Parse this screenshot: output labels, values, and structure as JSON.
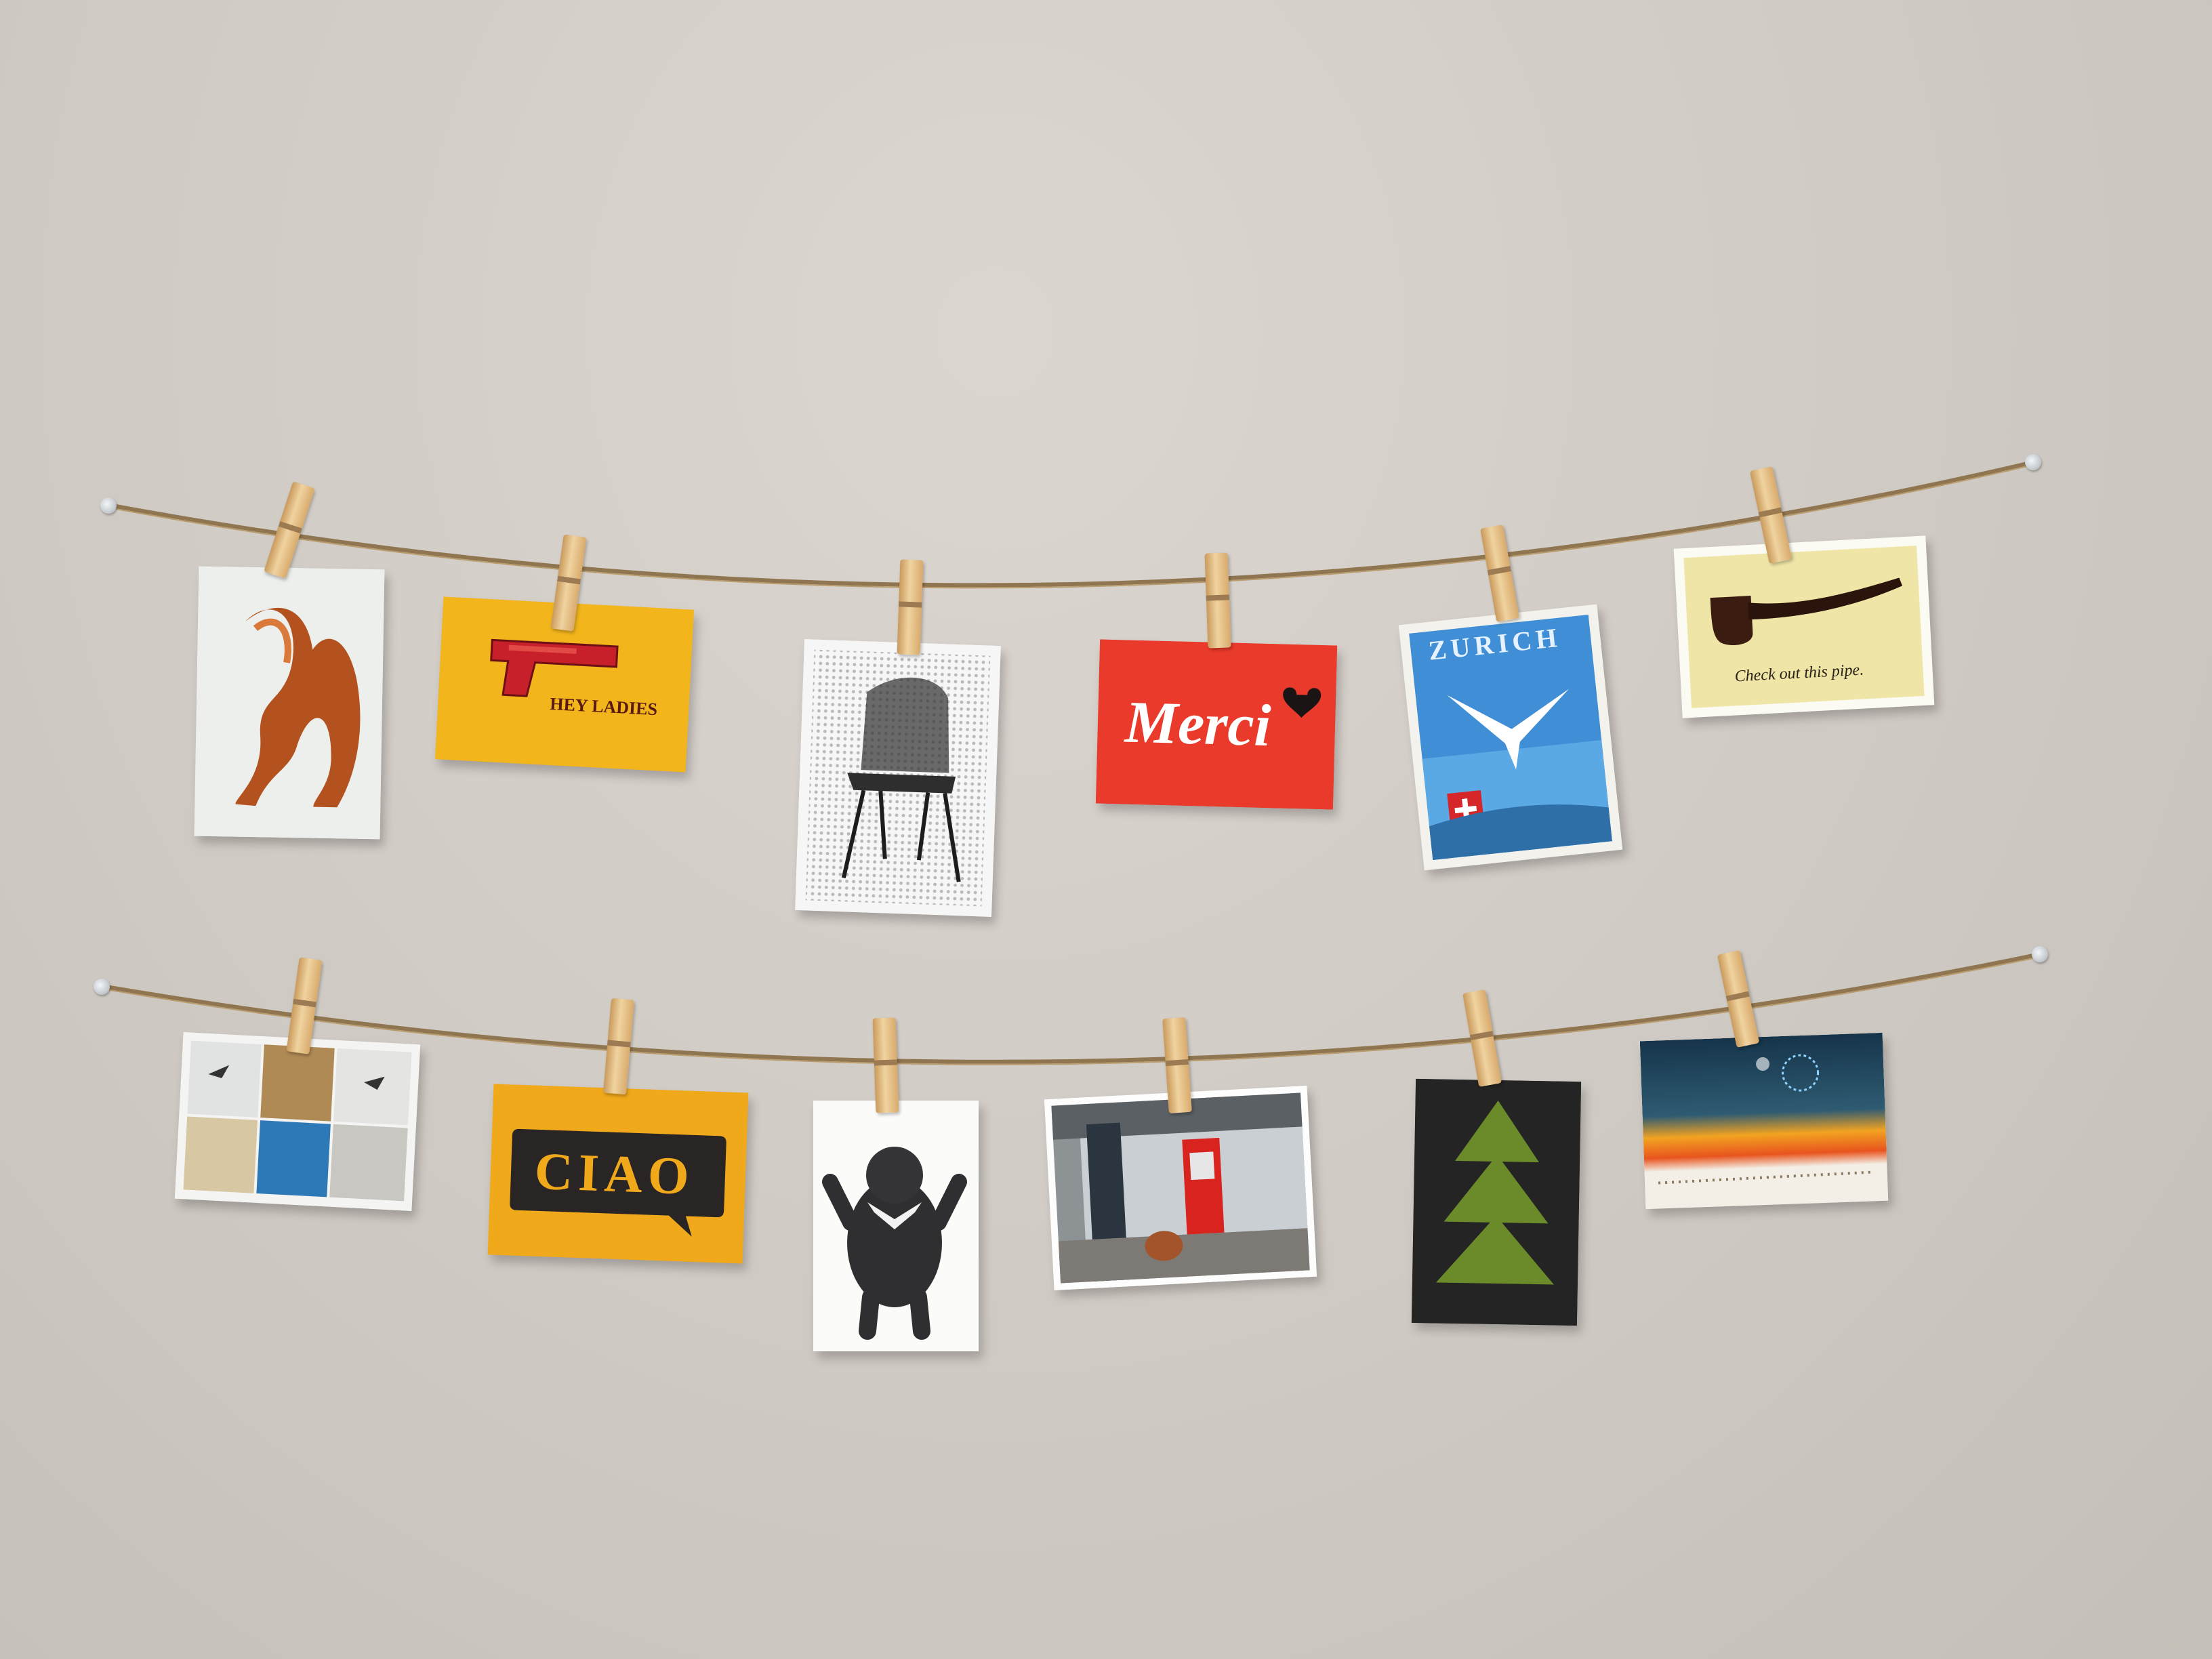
{
  "cards": {
    "hey_ladies": {
      "text": "HEY LADIES",
      "color": "#f2b51c"
    },
    "merci": {
      "text": "Merci",
      "color": "#ea3a2b"
    },
    "zurich": {
      "text": "ZURICH"
    },
    "pipe": {
      "text": "Check out this pipe."
    },
    "ciao": {
      "text": "CIAO",
      "color": "#f0a91b"
    }
  },
  "colors": {
    "wall": "#d6d0cb",
    "twine": "#8f7650",
    "pin": "#cfd6dc",
    "clip": "#e6c48d"
  }
}
